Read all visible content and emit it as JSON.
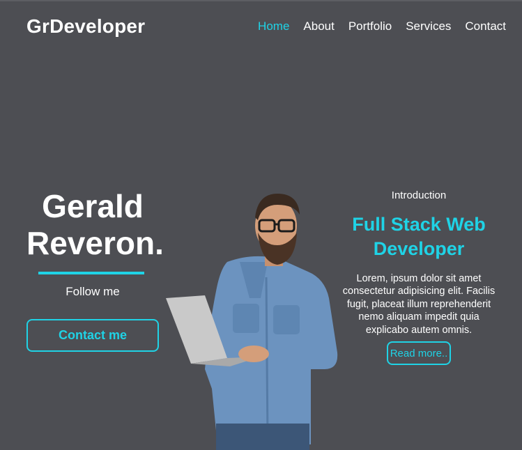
{
  "header": {
    "brand": "GrDeveloper",
    "nav": [
      "Home",
      "About",
      "Portfolio",
      "Services",
      "Contact"
    ],
    "active": "Home"
  },
  "hero": {
    "name_line1": "Gerald",
    "name_line2": "Reveron.",
    "follow": "Follow me",
    "contact_button": "Contact me"
  },
  "intro": {
    "label": "Introduction",
    "role": "Full Stack Web Developer",
    "description": "Lorem, ipsum dolor sit amet consectetur adipisicing elit. Facilis fugit, placeat illum reprehenderit nemo aliquam impedit quia explicabo autem omnis.",
    "read_more": "Read more.."
  },
  "colors": {
    "background": "#4d4e53",
    "accent": "#1fd3e6",
    "text": "#ffffff"
  }
}
